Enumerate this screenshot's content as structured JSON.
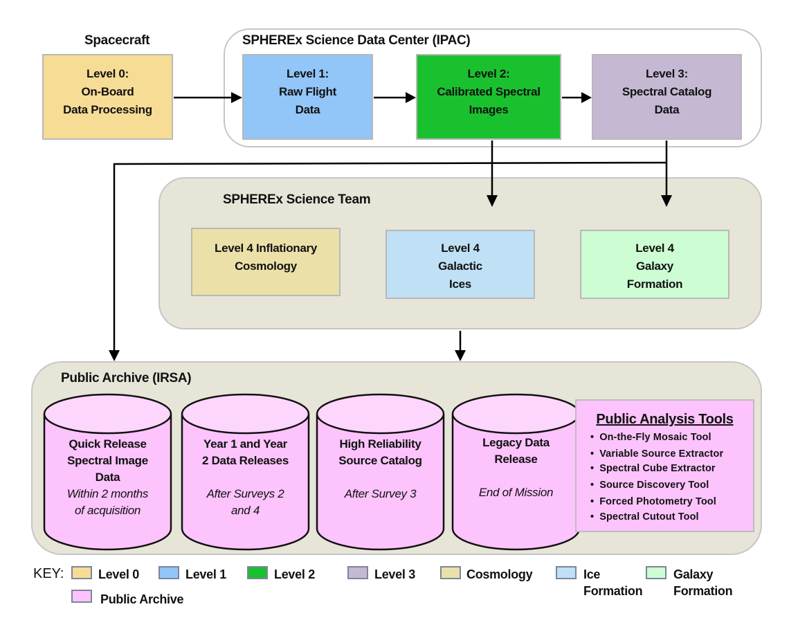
{
  "spacecraft": {
    "title": "Spacecraft",
    "level0": {
      "lines": [
        "Level 0:",
        "On-Board",
        "Data Processing"
      ],
      "color": "#f7dc96"
    }
  },
  "ipac": {
    "title": "SPHEREx Science Data Center (IPAC)",
    "level1": {
      "lines": [
        "Level 1:",
        "Raw Flight",
        "Data"
      ],
      "color": "#92c5f8"
    },
    "level2": {
      "lines": [
        "Level 2:",
        "Calibrated Spectral",
        "Images"
      ],
      "color": "#1ac12f"
    },
    "level3": {
      "lines": [
        "Level 3:",
        "Spectral Catalog",
        "Data"
      ],
      "color": "#c5b8d3"
    }
  },
  "science_team": {
    "title": "SPHEREx Science Team",
    "background": "#e6e5d8",
    "cosmology": {
      "lines": [
        "Level 4 Inflationary",
        "Cosmology"
      ],
      "color": "#ebe0a8"
    },
    "ices": {
      "lines": [
        "Level 4",
        "Galactic",
        "Ices"
      ],
      "color": "#bfe0f5"
    },
    "galaxy": {
      "lines": [
        "Level 4",
        "Galaxy",
        "Formation"
      ],
      "color": "#cdfdd3"
    }
  },
  "archive": {
    "title": "Public Archive (IRSA)",
    "background": "#e6e5d8",
    "cylinder_color": "#fcc3fc",
    "cylinders": [
      {
        "title_lines": [
          "Quick Release",
          "Spectral Image",
          "Data"
        ],
        "sub_lines": [
          "Within 2 months",
          "of acquisition"
        ]
      },
      {
        "title_lines": [
          "Year 1 and Year",
          "2 Data Releases"
        ],
        "sub_lines": [
          "",
          "After Surveys 2",
          "and 4"
        ]
      },
      {
        "title_lines": [
          "High Reliability",
          "Source Catalog"
        ],
        "sub_lines": [
          "",
          "After Survey 3"
        ]
      },
      {
        "title_lines": [
          "Legacy Data",
          "Release"
        ],
        "sub_lines": [
          "",
          "End of Mission"
        ]
      }
    ],
    "tools": {
      "title": "Public Analysis Tools",
      "items": [
        "On-the-Fly Mosaic  Tool",
        "Variable Source Extractor",
        "Spectral Cube Extractor",
        "Source Discovery Tool",
        "Forced Photometry Tool",
        "Spectral Cutout Tool"
      ]
    }
  },
  "key": {
    "label": "KEY:",
    "items": [
      {
        "label": "Level 0",
        "color": "#f7dc96"
      },
      {
        "label": "Level 1",
        "color": "#92c5f8"
      },
      {
        "label": "Level 2",
        "color": "#1ac12f"
      },
      {
        "label": "Level 3",
        "color": "#c5b8d3"
      },
      {
        "label": "Cosmology",
        "color": "#ebe0a8"
      },
      {
        "label": "Ice Formation",
        "lines": [
          "Ice",
          "Formation"
        ],
        "color": "#bfe0f5"
      },
      {
        "label": "Galaxy Formation",
        "lines": [
          "Galaxy",
          "Formation"
        ],
        "color": "#cdfdd3"
      },
      {
        "label": "Public Archive",
        "color": "#fcc3fc"
      }
    ]
  }
}
